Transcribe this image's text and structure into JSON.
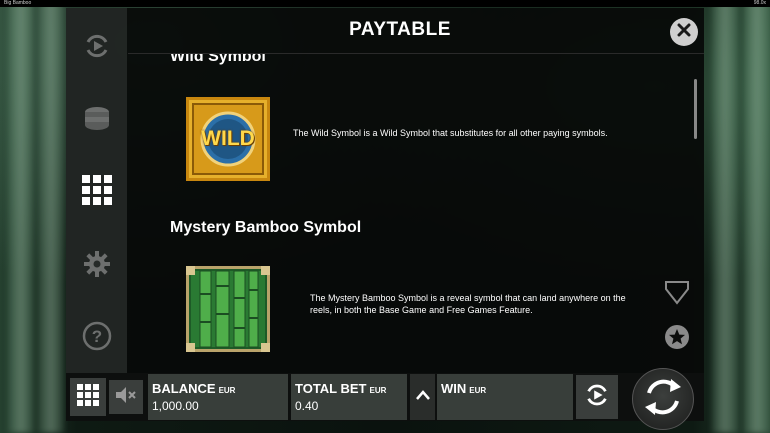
{
  "window": {
    "title": "Big Bamboo",
    "right_label": "98.0x"
  },
  "panel": {
    "title": "PAYTABLE"
  },
  "sidebar": {
    "items": [
      {
        "name": "autoplay",
        "icon": "autoplay-icon"
      },
      {
        "name": "bet",
        "icon": "coins-icon"
      },
      {
        "name": "paytable",
        "icon": "grid-icon",
        "active": true
      },
      {
        "name": "settings",
        "icon": "gear-icon"
      },
      {
        "name": "help",
        "icon": "help-icon"
      }
    ]
  },
  "content": {
    "sections": [
      {
        "heading": "Wild Symbol",
        "symbol_text": "WILD",
        "description": "The Wild Symbol is a Wild Symbol that substitutes for all other paying symbols."
      },
      {
        "heading": "Mystery Bamboo Symbol",
        "description": "The Mystery Bamboo Symbol is a reveal symbol that can land anywhere on the reels, in both the Base Game and Free Games Feature."
      }
    ]
  },
  "bottom": {
    "balance": {
      "label": "BALANCE",
      "currency": "EUR",
      "value": "1,000.00"
    },
    "total_bet": {
      "label": "TOTAL BET",
      "currency": "EUR",
      "value": "0.40"
    },
    "win": {
      "label": "WIN",
      "currency": "EUR",
      "value": ""
    }
  },
  "colors": {
    "accent_gold": "#d9a21c",
    "bamboo_green": "#2f8a3a",
    "panel_bg": "#080a09"
  }
}
